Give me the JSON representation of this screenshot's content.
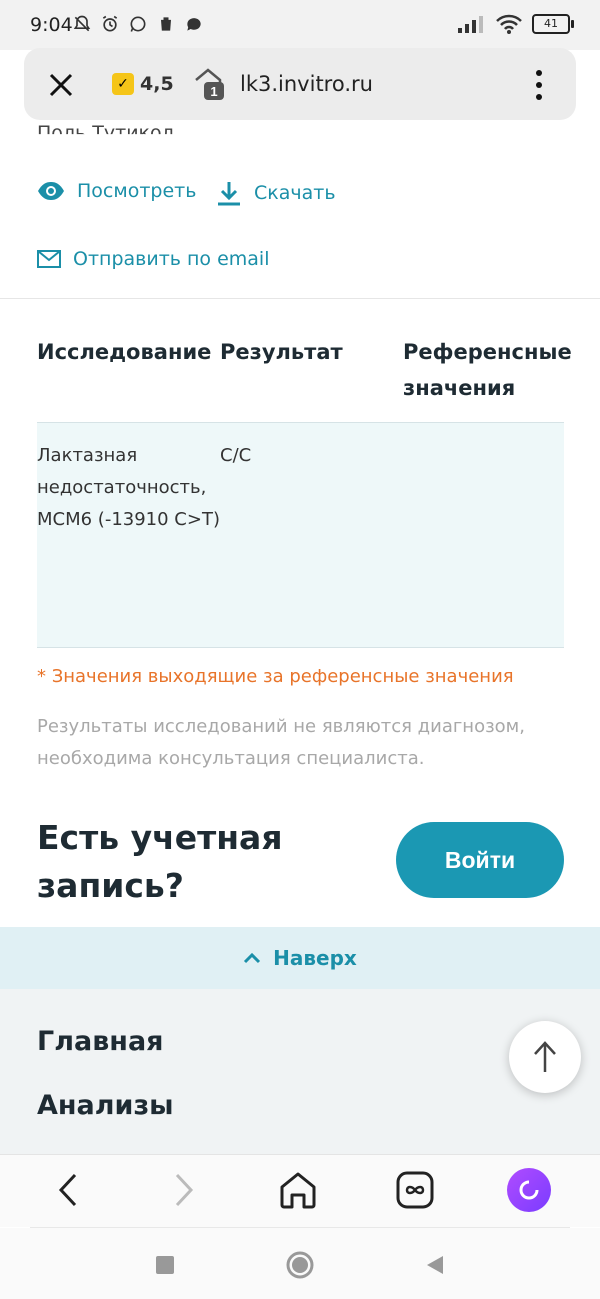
{
  "status_bar": {
    "time": "9:04",
    "battery": "41"
  },
  "browser": {
    "rating": "4,5",
    "tab_count": "1",
    "url": "lk3.invitro.ru"
  },
  "content": {
    "cut_off_text": "Поль Тутикол",
    "actions": {
      "view": "Посмотреть",
      "download": "Скачать",
      "email": "Отправить по email"
    },
    "table": {
      "headers": [
        "Исследование",
        "Результат",
        "Референсные значения"
      ],
      "rows": [
        {
          "name": "Лактазная недостаточность, MCM6 (-13910 C>T)",
          "result": "C/C",
          "reference": ""
        }
      ]
    },
    "note_orange": "* Значения выходящие за референсные значения",
    "note_gray": "Результаты исследований не являются диагнозом, необходима консультация специалиста.",
    "account_title": "Есть учетная запись?",
    "login_button": "Войти",
    "back_to_top": "Наверх"
  },
  "footer": {
    "items": [
      "Главная",
      "Анализы"
    ]
  },
  "colors": {
    "accent": "#1b98b3",
    "link": "#1b8fa8",
    "warning": "#e8742a",
    "row_bg": "#eef8f9"
  },
  "icons": {
    "view": "eye-icon",
    "download": "download-icon",
    "email": "mail-icon",
    "back_to_top": "arrow-up-icon"
  }
}
